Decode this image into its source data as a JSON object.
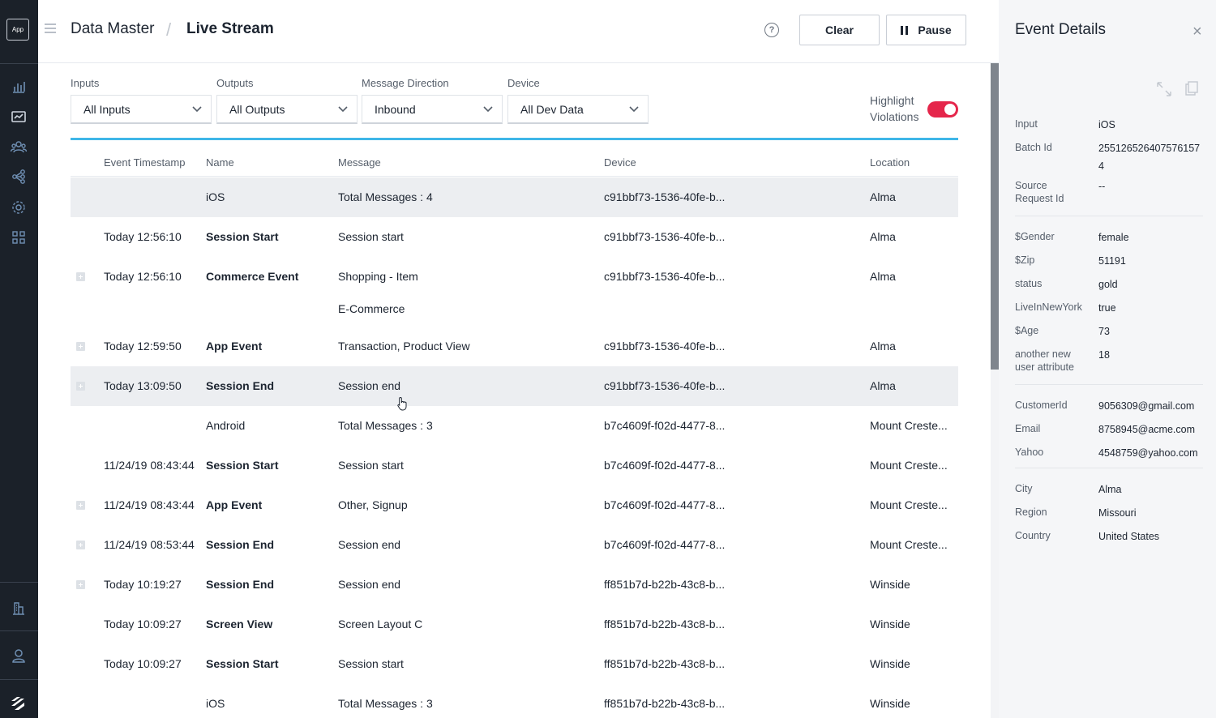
{
  "app": {
    "logo": "App"
  },
  "leftnav": {
    "icons": [
      "bar-chart-icon",
      "live-stream-icon",
      "users-icon",
      "connections-icon",
      "settings-icon",
      "apps-grid-icon",
      "city-icon",
      "user-icon",
      "brand-logo-icon"
    ]
  },
  "header": {
    "breadcrumb_parent": "Data Master",
    "breadcrumb_separator": "/",
    "breadcrumb_current": "Live Stream",
    "help": "?",
    "clear_label": "Clear",
    "pause_label": "Pause"
  },
  "filters": {
    "inputs": {
      "label": "Inputs",
      "value": "All Inputs"
    },
    "outputs": {
      "label": "Outputs",
      "value": "All Outputs"
    },
    "direction": {
      "label": "Message Direction",
      "value": "Inbound"
    },
    "device": {
      "label": "Device",
      "value": "All Dev Data"
    },
    "highlight_line1": "Highlight",
    "highlight_line2": "Violations",
    "highlight_on": true
  },
  "table": {
    "columns": [
      "Event Timestamp",
      "Name",
      "Message",
      "Device",
      "Location"
    ],
    "rows": [
      {
        "timestamp": "",
        "name": "iOS",
        "message": "Total Messages : 4",
        "message2": "",
        "device": "c91bbf73-1536-40fe-b...",
        "location": "Alma",
        "expandable": false,
        "bold": false,
        "highlighted": true
      },
      {
        "timestamp": "Today 12:56:10",
        "name": "Session Start",
        "message": "Session start",
        "message2": "",
        "device": "c91bbf73-1536-40fe-b...",
        "location": "Alma",
        "expandable": false,
        "bold": true,
        "highlighted": false
      },
      {
        "timestamp": "Today 12:56:10",
        "name": "Commerce Event",
        "message": "Shopping - Item",
        "message2": "E-Commerce",
        "device": "c91bbf73-1536-40fe-b...",
        "location": "Alma",
        "expandable": true,
        "bold": true,
        "highlighted": false
      },
      {
        "timestamp": "Today 12:59:50",
        "name": "App Event",
        "message": "Transaction, Product View",
        "message2": "",
        "device": "c91bbf73-1536-40fe-b...",
        "location": "Alma",
        "expandable": true,
        "bold": true,
        "highlighted": false
      },
      {
        "timestamp": "Today 13:09:50",
        "name": "Session End",
        "message": "Session end",
        "message2": "",
        "device": "c91bbf73-1536-40fe-b...",
        "location": "Alma",
        "expandable": true,
        "bold": true,
        "highlighted": true
      },
      {
        "timestamp": "",
        "name": "Android",
        "message": "Total Messages : 3",
        "message2": "",
        "device": "b7c4609f-f02d-4477-8...",
        "location": "Mount Creste...",
        "expandable": false,
        "bold": false,
        "highlighted": false
      },
      {
        "timestamp": "11/24/19 08:43:44",
        "name": "Session Start",
        "message": "Session start",
        "message2": "",
        "device": "b7c4609f-f02d-4477-8...",
        "location": "Mount Creste...",
        "expandable": false,
        "bold": true,
        "highlighted": false
      },
      {
        "timestamp": "11/24/19 08:43:44",
        "name": "App Event",
        "message": "Other, Signup",
        "message2": "",
        "device": "b7c4609f-f02d-4477-8...",
        "location": "Mount Creste...",
        "expandable": true,
        "bold": true,
        "highlighted": false
      },
      {
        "timestamp": "11/24/19 08:53:44",
        "name": "Session End",
        "message": "Session end",
        "message2": "",
        "device": "b7c4609f-f02d-4477-8...",
        "location": "Mount Creste...",
        "expandable": true,
        "bold": true,
        "highlighted": false
      },
      {
        "timestamp": "Today 10:19:27",
        "name": "Session End",
        "message": "Session end",
        "message2": "",
        "device": "ff851b7d-b22b-43c8-b...",
        "location": "Winside",
        "expandable": true,
        "bold": true,
        "highlighted": false
      },
      {
        "timestamp": "Today 10:09:27",
        "name": "Screen View",
        "message": "Screen Layout C",
        "message2": "",
        "device": "ff851b7d-b22b-43c8-b...",
        "location": "Winside",
        "expandable": false,
        "bold": true,
        "highlighted": false
      },
      {
        "timestamp": "Today 10:09:27",
        "name": "Session Start",
        "message": "Session start",
        "message2": "",
        "device": "ff851b7d-b22b-43c8-b...",
        "location": "Winside",
        "expandable": false,
        "bold": true,
        "highlighted": false
      },
      {
        "timestamp": "",
        "name": "iOS",
        "message": "Total Messages : 3",
        "message2": "",
        "device": "ff851b7d-b22b-43c8-b...",
        "location": "Winside",
        "expandable": false,
        "bold": false,
        "highlighted": false
      }
    ]
  },
  "details": {
    "title": "Event Details",
    "close": "×",
    "groups": [
      [
        {
          "label": "Input",
          "value": "iOS"
        },
        {
          "label": "Batch Id",
          "value": "255126526407576157\n4"
        },
        {
          "label": "Source\nRequest Id",
          "value": "--"
        }
      ],
      [
        {
          "label": "$Gender",
          "value": "female"
        },
        {
          "label": "$Zip",
          "value": "51191"
        },
        {
          "label": "status",
          "value": "gold"
        },
        {
          "label": "LiveInNewYork",
          "value": "true"
        },
        {
          "label": "$Age",
          "value": "73"
        },
        {
          "label": "another new\nuser attribute",
          "value": "18"
        }
      ],
      [
        {
          "label": "CustomerId",
          "value": "9056309@gmail.com"
        },
        {
          "label": "Email",
          "value": "8758945@acme.com"
        },
        {
          "label": "Yahoo",
          "value": "4548759@yahoo.com"
        }
      ],
      [
        {
          "label": "City",
          "value": "Alma"
        },
        {
          "label": "Region",
          "value": "Missouri"
        },
        {
          "label": "Country",
          "value": "United States"
        }
      ]
    ]
  },
  "colors": {
    "nav_bg": "#1b2129",
    "accent_blue": "#3fb6e8",
    "toggle_red": "#e5264b",
    "row_highlight": "#eceef1",
    "panel_bg": "#f5f6f8"
  }
}
